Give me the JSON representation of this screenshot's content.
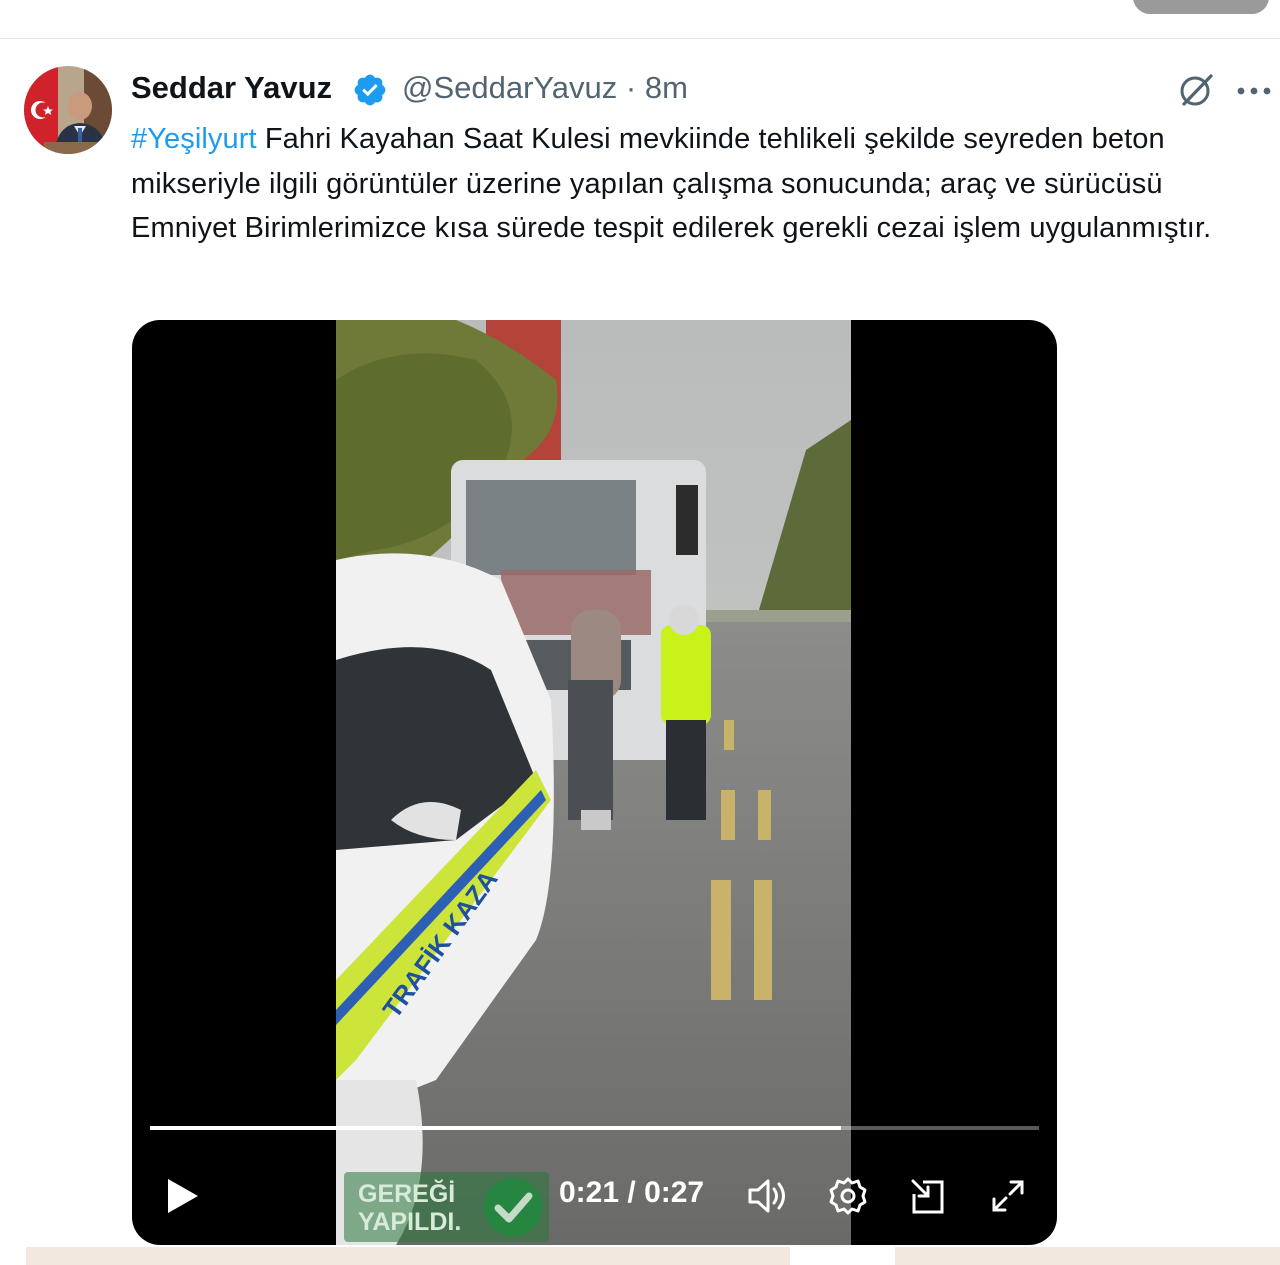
{
  "author": {
    "name": "Seddar Yavuz",
    "handle": "@SeddarYavuz",
    "separator": "·",
    "time": "8m"
  },
  "tweet": {
    "hashtag": "#Yeşilyurt",
    "body": " Fahri Kayahan Saat Kulesi mevkiinde tehlikeli şekilde seyreden beton mikseriyle ilgili görüntüler üzerine yapılan çalışma sonucunda; araç ve sürücüsü Emniyet Birimlerimizce kısa sürede tespit edilerek gerekli cezai işlem uygulanmıştır."
  },
  "video": {
    "current_time": "0:21",
    "duration": "0:27",
    "time_sep": " / ",
    "progress_fraction": 0.7778,
    "car_text": "TRAFİK KAZA",
    "stamp_line1": "GEREĞİ",
    "stamp_line2": "YAPILDI."
  },
  "icons": {
    "verified": "verified-badge-icon",
    "grok": "grok-icon",
    "more": "more-icon",
    "play": "play-icon",
    "volume": "volume-icon",
    "settings": "gear-icon",
    "pip": "picture-in-picture-icon",
    "fullscreen": "fullscreen-icon"
  },
  "colors": {
    "accent": "#1d9bf0",
    "secondary_text": "#536471",
    "primary_text": "#0f1419"
  }
}
